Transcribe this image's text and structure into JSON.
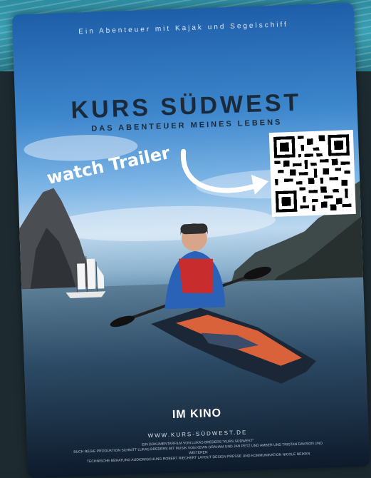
{
  "poster": {
    "tagline": "Ein Abenteuer mit Kajak und Segelschiff",
    "title": "KURS SÜDWEST",
    "subtitle": "DAS ABENTEUER MEINES LEBENS",
    "overlay_text": "watch Trailer",
    "release": "IM KINO",
    "website": "WWW.KURS-SÜDWEST.DE",
    "credits": [
      "EIN DOKUMENTARFILM VON LUKAS BREDERS \"KURS SÜDWEST\"",
      "BUCH REGIE PRODUKTION SCHNITT LUKAS BREDERS MIT MUSIK VON KEVIN GRAHAM UND JAN PETZ UND AMBER UND TRISTAN DAVISON UND WEITEREN",
      "TECHNISCHE BERATUNG AUDIOMISCHUNG ROBERT RIECHERT LAYOUT DESIGN PRESSE UND KOMMUNIKATION NICOLE NEIKEN"
    ]
  },
  "colors": {
    "title": "#1b2a3a",
    "overlay": "#ffffff",
    "background": "#1d2b30"
  }
}
